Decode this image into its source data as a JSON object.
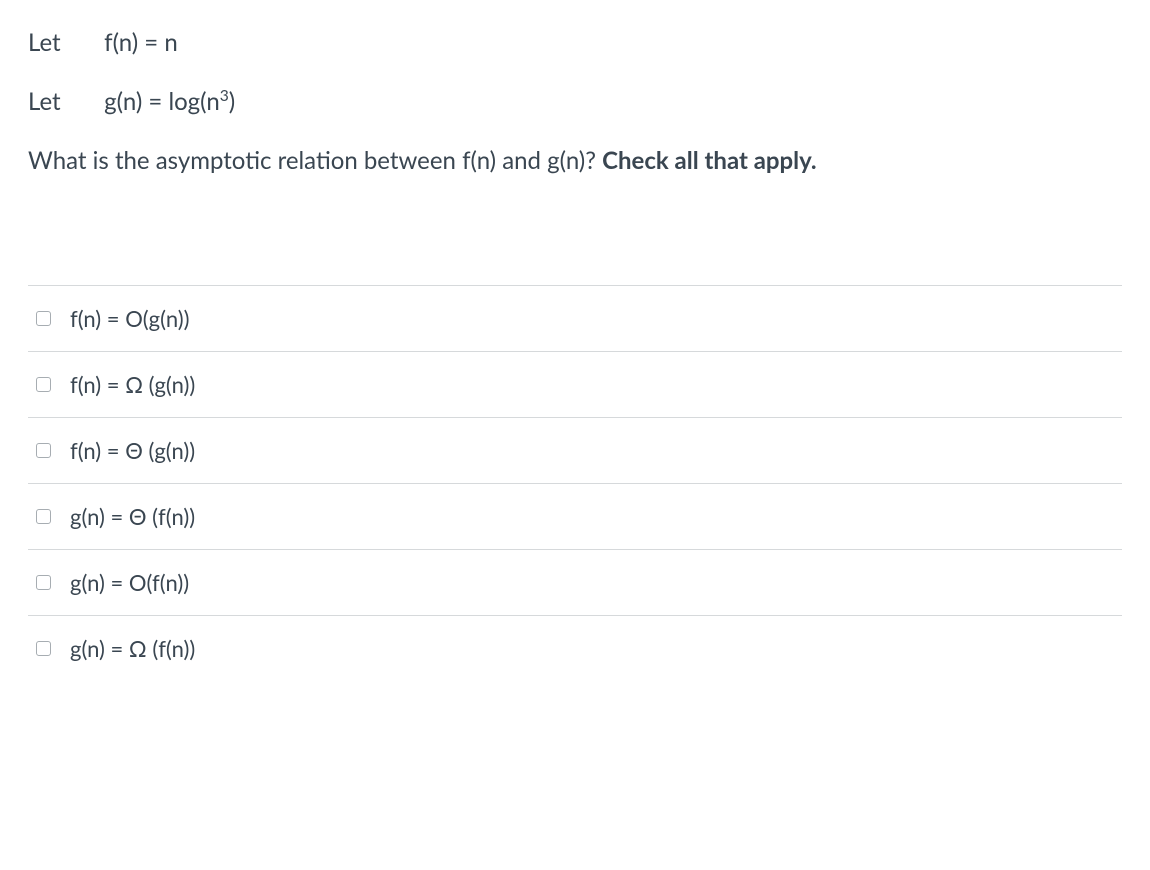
{
  "prompt": {
    "line1_let": "Let",
    "line1_expr": "f(n) = n",
    "line2_let": "Let",
    "line2_expr_html": "g(n) = log(n<sup>3</sup>)",
    "question_text": "What is the asymptotic relation between f(n) and g(n)? ",
    "question_bold": "Check all that apply."
  },
  "options": [
    {
      "label": "f(n) = O(g(n))"
    },
    {
      "label": "f(n) = Ω (g(n))"
    },
    {
      "label": "f(n) = Θ (g(n))"
    },
    {
      "label": "g(n) = Θ (f(n))"
    },
    {
      "label": "g(n) = O(f(n))"
    },
    {
      "label": "g(n) = Ω (f(n))"
    }
  ]
}
